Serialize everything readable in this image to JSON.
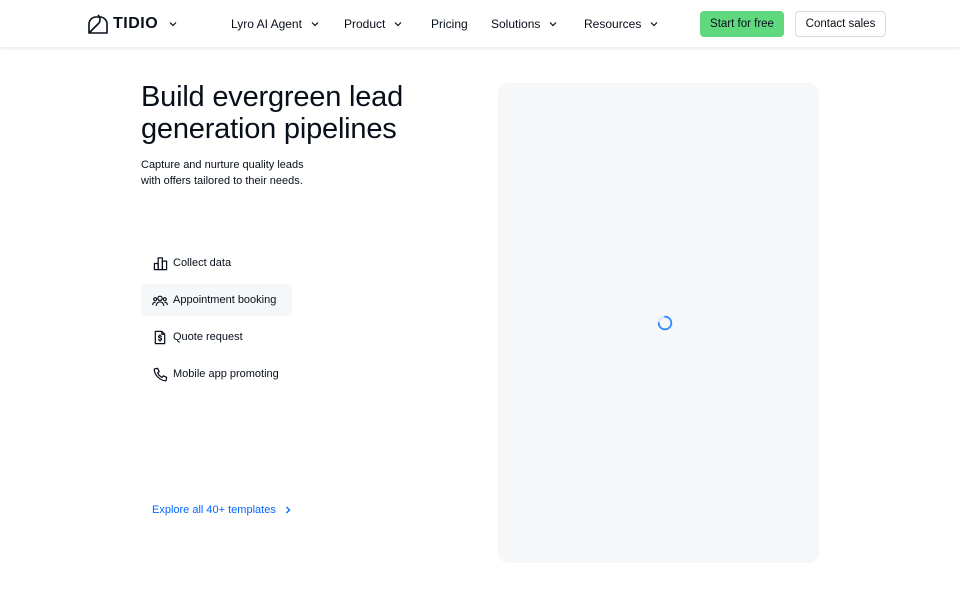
{
  "header": {
    "logo_text": "TIDIO",
    "nav": [
      {
        "label": "Lyro AI Agent",
        "has_dropdown": true
      },
      {
        "label": "Product",
        "has_dropdown": true
      },
      {
        "label": "Pricing",
        "has_dropdown": false
      },
      {
        "label": "Solutions",
        "has_dropdown": true
      },
      {
        "label": "Resources",
        "has_dropdown": true
      }
    ],
    "start_button": "Start for free",
    "contact_button": "Contact sales"
  },
  "hero": {
    "title_line1": "Build evergreen lead",
    "title_line2": "generation pipelines",
    "subtitle_line1": "Capture and nurture quality leads",
    "subtitle_line2": "with offers tailored to their needs."
  },
  "templates": [
    {
      "label": "Collect data",
      "icon": "bar-chart-icon",
      "active": false
    },
    {
      "label": "Appointment booking",
      "icon": "people-icon",
      "active": true
    },
    {
      "label": "Quote request",
      "icon": "document-dollar-icon",
      "active": false
    },
    {
      "label": "Mobile app promoting",
      "icon": "phone-icon",
      "active": false
    }
  ],
  "explore_link": "Explore all 40+ templates",
  "colors": {
    "primary_green": "#60d97e",
    "link_blue": "#0566ff",
    "text_dark": "#080f1a",
    "panel_bg": "#f5f7f9",
    "spinner_blue": "#2d8cff"
  },
  "preview": {
    "state": "loading"
  }
}
